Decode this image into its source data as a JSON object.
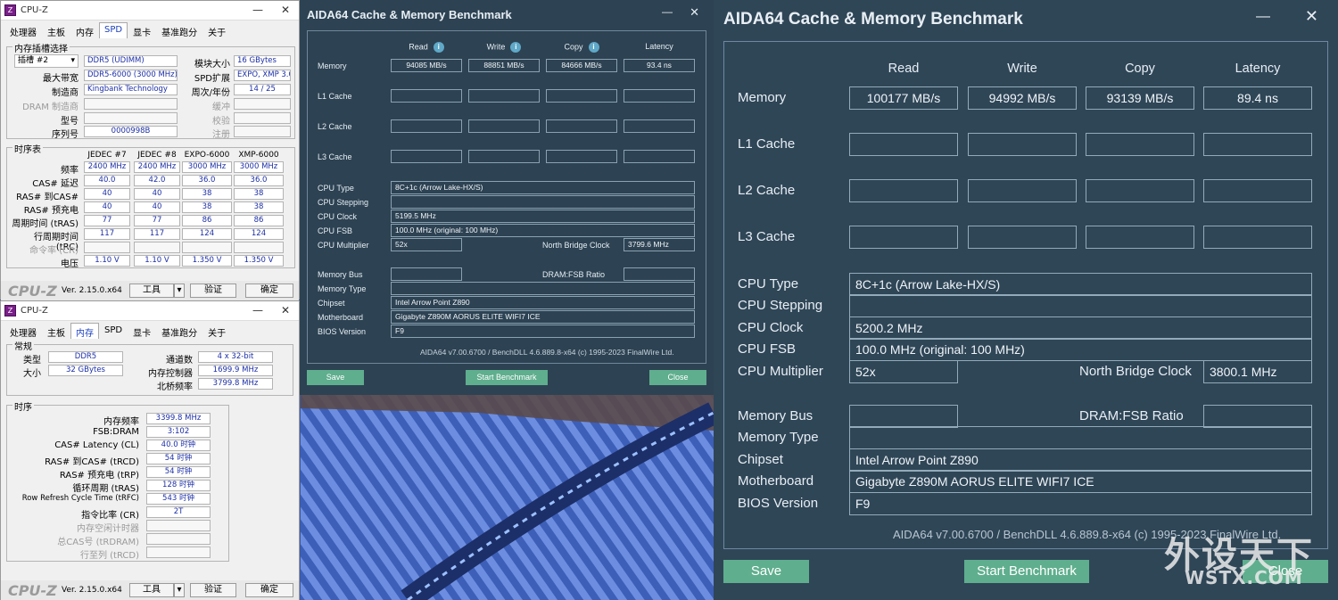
{
  "cpuz_top": {
    "title": "CPU-Z",
    "tabs": [
      "处理器",
      "主板",
      "内存",
      "SPD",
      "显卡",
      "基准跑分",
      "关于"
    ],
    "active_tab": "SPD",
    "slot_group": "内存插槽选择",
    "slot_value": "插槽 #2",
    "slot_type": "DDR5 (UDIMM)",
    "module_size_label": "模块大小",
    "module_size": "16 GBytes",
    "max_bw_label": "最大带宽",
    "max_bw": "DDR5-6000 (3000 MHz)",
    "spd_ext_label": "SPD扩展",
    "spd_ext": "EXPO, XMP 3.0",
    "manufacturer_label": "制造商",
    "manufacturer": "Kingbank Technology",
    "week_year_label": "周次/年份",
    "week_year": "14 / 25",
    "dram_mfr_label": "DRAM 制造商",
    "buffer_label": "缓冲",
    "part_label": "型号",
    "check_label": "校验",
    "serial_label": "序列号",
    "serial": "0000998B",
    "reg_label": "注册",
    "timing_group": "时序表",
    "timing_headers": [
      "JEDEC #7",
      "JEDEC #8",
      "EXPO-6000",
      "XMP-6000"
    ],
    "timing_rows": [
      {
        "label": "频率",
        "values": [
          "2400 MHz",
          "2400 MHz",
          "3000 MHz",
          "3000 MHz"
        ]
      },
      {
        "label": "CAS# 延迟",
        "values": [
          "40.0",
          "42.0",
          "36.0",
          "36.0"
        ]
      },
      {
        "label": "RAS# 到CAS#",
        "values": [
          "40",
          "40",
          "38",
          "38"
        ]
      },
      {
        "label": "RAS# 预充电",
        "values": [
          "40",
          "40",
          "38",
          "38"
        ]
      },
      {
        "label": "周期时间 (tRAS)",
        "values": [
          "77",
          "77",
          "86",
          "86"
        ]
      },
      {
        "label": "行周期时间 (tRC)",
        "values": [
          "117",
          "117",
          "124",
          "124"
        ]
      },
      {
        "label": "命令率 (CR)",
        "values": [
          "",
          "",
          "",
          ""
        ]
      },
      {
        "label": "电压",
        "values": [
          "1.10 V",
          "1.10 V",
          "1.350 V",
          "1.350 V"
        ]
      }
    ],
    "version": "Ver. 2.15.0.x64",
    "tools": "工具",
    "validate": "验证",
    "ok": "确定"
  },
  "cpuz_bottom": {
    "title": "CPU-Z",
    "tabs": [
      "处理器",
      "主板",
      "内存",
      "SPD",
      "显卡",
      "基准跑分",
      "关于"
    ],
    "active_tab": "内存",
    "general_group": "常规",
    "type_label": "类型",
    "type": "DDR5",
    "channels_label": "通道数",
    "channels": "4 x 32-bit",
    "size_label": "大小",
    "size": "32 GBytes",
    "mem_ctrl_label": "内存控制器",
    "mem_ctrl": "1699.9 MHz",
    "nb_label": "北桥频率",
    "nb": "3799.8 MHz",
    "timing_group": "时序",
    "rows": [
      {
        "label": "内存频率",
        "value": "3399.8 MHz"
      },
      {
        "label": "FSB:DRAM",
        "value": "3:102"
      },
      {
        "label": "CAS# Latency (CL)",
        "value": "40.0 时钟"
      },
      {
        "label": "RAS# 到CAS# (tRCD)",
        "value": "54 时钟"
      },
      {
        "label": "RAS# 预充电 (tRP)",
        "value": "54 时钟"
      },
      {
        "label": "循环周期 (tRAS)",
        "value": "128 时钟"
      },
      {
        "label": "Row Refresh Cycle Time (tRFC)",
        "value": "543 时钟"
      },
      {
        "label": "指令比率 (CR)",
        "value": "2T"
      },
      {
        "label": "内存空闲计时器",
        "value": ""
      },
      {
        "label": "总CAS号 (tRDRAM)",
        "value": ""
      },
      {
        "label": "行至列 (tRCD)",
        "value": ""
      }
    ],
    "version": "Ver. 2.15.0.x64",
    "tools": "工具",
    "validate": "验证",
    "ok": "确定"
  },
  "aida_small": {
    "title": "AIDA64 Cache & Memory Benchmark",
    "headers": [
      "Read",
      "Write",
      "Copy",
      "Latency"
    ],
    "memory": {
      "label": "Memory",
      "read": "94085 MB/s",
      "write": "88851 MB/s",
      "copy": "84666 MB/s",
      "latency": "93.4 ns"
    },
    "l1": "L1 Cache",
    "l2": "L2 Cache",
    "l3": "L3 Cache",
    "cpu_type_label": "CPU Type",
    "cpu_type": "8C+1c   (Arrow Lake-HX/S)",
    "cpu_stepping_label": "CPU Stepping",
    "cpu_clock_label": "CPU Clock",
    "cpu_clock": "5199.5 MHz",
    "cpu_fsb_label": "CPU FSB",
    "cpu_fsb": "100.0 MHz  (original: 100 MHz)",
    "cpu_mult_label": "CPU Multiplier",
    "cpu_mult": "52x",
    "nb_clock_label": "North Bridge Clock",
    "nb_clock": "3799.6 MHz",
    "mem_bus_label": "Memory Bus",
    "dram_fsb_label": "DRAM:FSB Ratio",
    "mem_type_label": "Memory Type",
    "chipset_label": "Chipset",
    "chipset": "Intel Arrow Point Z890",
    "mobo_label": "Motherboard",
    "mobo": "Gigabyte Z890M AORUS ELITE WIFI7 ICE",
    "bios_label": "BIOS Version",
    "bios": "F9",
    "footer": "AIDA64 v7.00.6700 / BenchDLL 4.6.889.8-x64  (c) 1995-2023 FinalWire Ltd.",
    "save": "Save",
    "start": "Start Benchmark",
    "close": "Close"
  },
  "aida_big": {
    "title": "AIDA64 Cache & Memory Benchmark",
    "headers": [
      "Read",
      "Write",
      "Copy",
      "Latency"
    ],
    "memory": {
      "label": "Memory",
      "read": "100177 MB/s",
      "write": "94992 MB/s",
      "copy": "93139 MB/s",
      "latency": "89.4 ns"
    },
    "l1": "L1 Cache",
    "l2": "L2 Cache",
    "l3": "L3 Cache",
    "cpu_type_label": "CPU Type",
    "cpu_type": "8C+1c   (Arrow Lake-HX/S)",
    "cpu_stepping_label": "CPU Stepping",
    "cpu_clock_label": "CPU Clock",
    "cpu_clock": "5200.2 MHz",
    "cpu_fsb_label": "CPU FSB",
    "cpu_fsb": "100.0 MHz  (original: 100 MHz)",
    "cpu_mult_label": "CPU Multiplier",
    "cpu_mult": "52x",
    "nb_clock_label": "North Bridge Clock",
    "nb_clock": "3800.1 MHz",
    "mem_bus_label": "Memory Bus",
    "dram_fsb_label": "DRAM:FSB Ratio",
    "mem_type_label": "Memory Type",
    "chipset_label": "Chipset",
    "chipset": "Intel Arrow Point Z890",
    "mobo_label": "Motherboard",
    "mobo": "Gigabyte Z890M AORUS ELITE WIFI7 ICE",
    "bios_label": "BIOS Version",
    "bios": "F9",
    "footer": "AIDA64 v7.00.6700 / BenchDLL 4.6.889.8-x64  (c) 1995-2023 FinalWire Ltd.",
    "save": "Save",
    "start": "Start Benchmark",
    "close": "Close"
  },
  "watermark": {
    "cn": "外设天下",
    "url": "WSTX.COM"
  },
  "colors": {
    "aida_bg": "#2f4657",
    "aida_button": "#5fae8e",
    "cpuz_value": "#1c2fa8",
    "cpuz_active_tab": "#1a3fbf"
  }
}
